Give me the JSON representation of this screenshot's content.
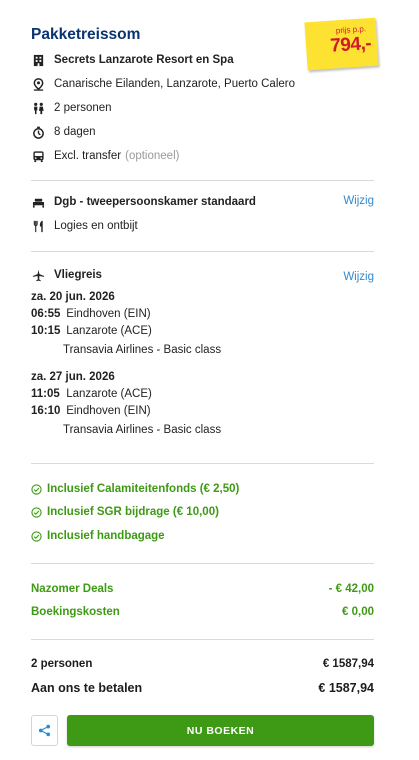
{
  "header": {
    "title": "Pakketreissom",
    "price_label": "prijs p.p.",
    "price_value": "794,-",
    "price_color": "#d2182c",
    "tag_color": "#fde232"
  },
  "hotel": {
    "name": "Secrets Lanzarote Resort en Spa",
    "name_icon": "building-icon",
    "location": "Canarische Eilanden, Lanzarote, Puerto Calero",
    "location_icon": "location-pin-icon",
    "persons": "2 personen",
    "persons_icon": "persons-icon",
    "duration": "8 dagen",
    "duration_icon": "stopwatch-icon",
    "transfer": "Excl. transfer",
    "transfer_note": "(optioneel)",
    "transfer_icon": "bus-icon"
  },
  "room": {
    "name": "Dgb - tweepersoonskamer standaard",
    "name_icon": "bed-icon",
    "change_label": "Wijzig",
    "board": "Logies en ontbijt",
    "board_icon": "cutlery-icon"
  },
  "flight": {
    "title": "Vliegreis",
    "title_icon": "airplane-icon",
    "change_label": "Wijzig",
    "outbound": {
      "date": "za. 20 jun. 2026",
      "dep_time": "06:55",
      "dep_airport": "Eindhoven (EIN)",
      "arr_time": "10:15",
      "arr_airport": "Lanzarote (ACE)",
      "carrier": "Transavia Airlines - Basic class"
    },
    "return": {
      "date": "za. 27 jun. 2026",
      "dep_time": "11:05",
      "dep_airport": "Lanzarote (ACE)",
      "arr_time": "16:10",
      "arr_airport": "Eindhoven (EIN)",
      "carrier": "Transavia Airlines - Basic class"
    }
  },
  "inclusions": [
    "Inclusief Calamiteitenfonds (€ 2,50)",
    "Inclusief SGR bijdrage (€ 10,00)",
    "Inclusief handbagage"
  ],
  "inclusion_icon": "check-circle-icon",
  "accent_green": "#3e9a14",
  "discounts": {
    "deal_label": "Nazomer Deals",
    "deal_value": "- € 42,00",
    "fee_label": "Boekingskosten",
    "fee_value": "€ 0,00"
  },
  "totals": {
    "persons_label": "2 personen",
    "persons_value": "€ 1587,94",
    "pay_label": "Aan ons te betalen",
    "pay_value": "€ 1587,94"
  },
  "actions": {
    "share_icon": "share-icon",
    "book_label": "NU BOEKEN"
  }
}
